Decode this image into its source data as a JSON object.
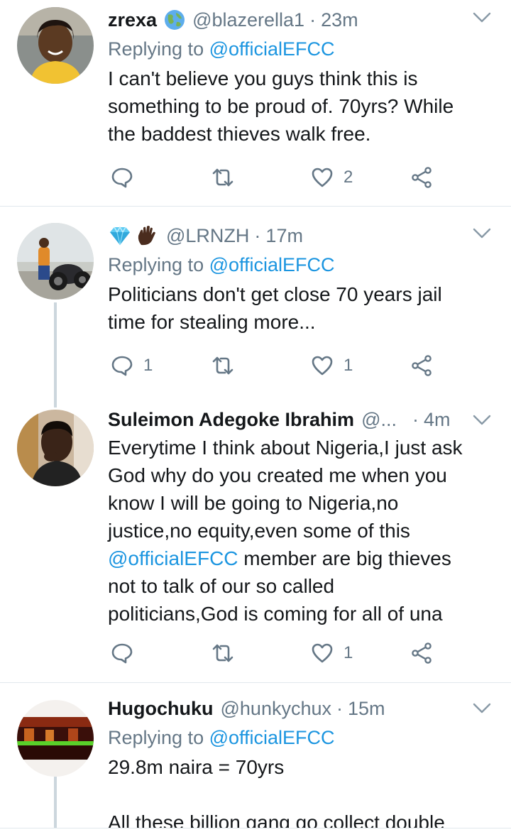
{
  "tweets": [
    {
      "name": "zrexa",
      "handle": "@blazerella1",
      "dot": "·",
      "time": "23m",
      "reply_prefix": "Replying to ",
      "reply_mention": "@officialEFCC",
      "text_lines": [
        "I can't believe you guys think this is",
        "something to be proud of. 70yrs? While",
        "the baddest thieves walk free."
      ],
      "replies": "",
      "retweets": "",
      "likes": "2"
    },
    {
      "name": "",
      "handle": "@LRNZH",
      "dot": "·",
      "time": "17m",
      "reply_prefix": "Replying to ",
      "reply_mention": "@officialEFCC",
      "text_lines": [
        "Politicians don't get close 70 years jail",
        "time for stealing more..."
      ],
      "replies": "1",
      "retweets": "",
      "likes": "1"
    },
    {
      "name": "Suleimon Adegoke Ibrahim",
      "handle": "@...",
      "dot": "·",
      "time": "4m",
      "text_lines": [
        "Everytime I think about Nigeria,I just ask",
        "God why do you created me when you",
        "know I will be going to Nigeria,no",
        "justice,no equity,even some of this"
      ],
      "text_mention": "@officialEFCC",
      "text_after_mention": " member are big thieves",
      "text_lines_end": [
        "not to talk of our so called",
        "politicians,God is coming for all of una"
      ],
      "replies": "",
      "retweets": "",
      "likes": "1"
    },
    {
      "name": "Hugochuku",
      "handle": "@hunkychux",
      "dot": "·",
      "time": "15m",
      "reply_prefix": "Replying to ",
      "reply_mention": "@officialEFCC",
      "text_lines": [
        "29.8m naira = 70yrs",
        "",
        "All these billion gang go collect double"
      ]
    }
  ],
  "icons": {
    "reply": "reply-icon",
    "retweet": "retweet-icon",
    "like": "heart-icon",
    "share": "share-icon",
    "menu": "chevron-down-icon"
  },
  "colors": {
    "mention": "#1b95e0",
    "secondary": "#657786",
    "divider": "#e1e8ed",
    "thread": "#ccd6dd"
  }
}
